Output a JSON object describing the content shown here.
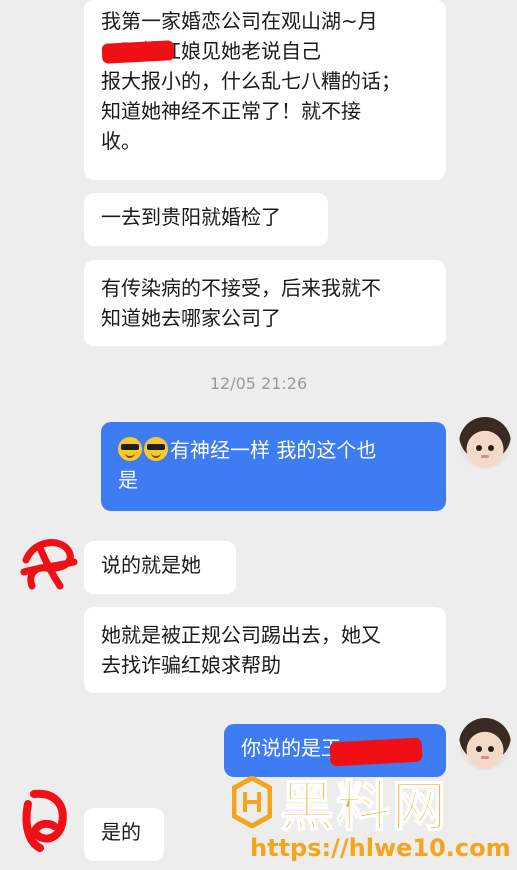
{
  "messages": [
    {
      "id": "m1",
      "side": "left",
      "text": "我第一家婚恋公司在观山湖~月\n，可能红娘见她老说自己\n报大报小的，什么乱七八糟的话；\n知道她神经不正常了！就不接\n收。"
    },
    {
      "id": "m2",
      "side": "left",
      "text": "一去到贵阳就婚检了"
    },
    {
      "id": "m3",
      "side": "left",
      "text": "有传染病的不接受，后来我就不\n知道她去哪家公司了"
    },
    {
      "id": "m4",
      "side": "right",
      "text": "有神经一样  我的这个也\n是"
    },
    {
      "id": "m5",
      "side": "left",
      "text": "说的就是她"
    },
    {
      "id": "m6",
      "side": "left",
      "text": "她就是被正规公司踢出去，她又\n去找诈骗红娘求帮助"
    },
    {
      "id": "m7",
      "side": "right",
      "text": "你说的是王"
    },
    {
      "id": "m8",
      "side": "left",
      "text": "是的"
    }
  ],
  "timestamp": "12/05 21:26",
  "emoji_icons": [
    "sunglasses-face-icon",
    "sunglasses-face-icon"
  ],
  "watermark": {
    "brand": "黑料网",
    "url": "https://hlwe10.com"
  },
  "colors": {
    "background": "#ededed",
    "left_bubble": "#ffffff",
    "right_bubble": "#3d7cf2",
    "watermark": "#f4a51c",
    "redaction": "#f00f14"
  }
}
